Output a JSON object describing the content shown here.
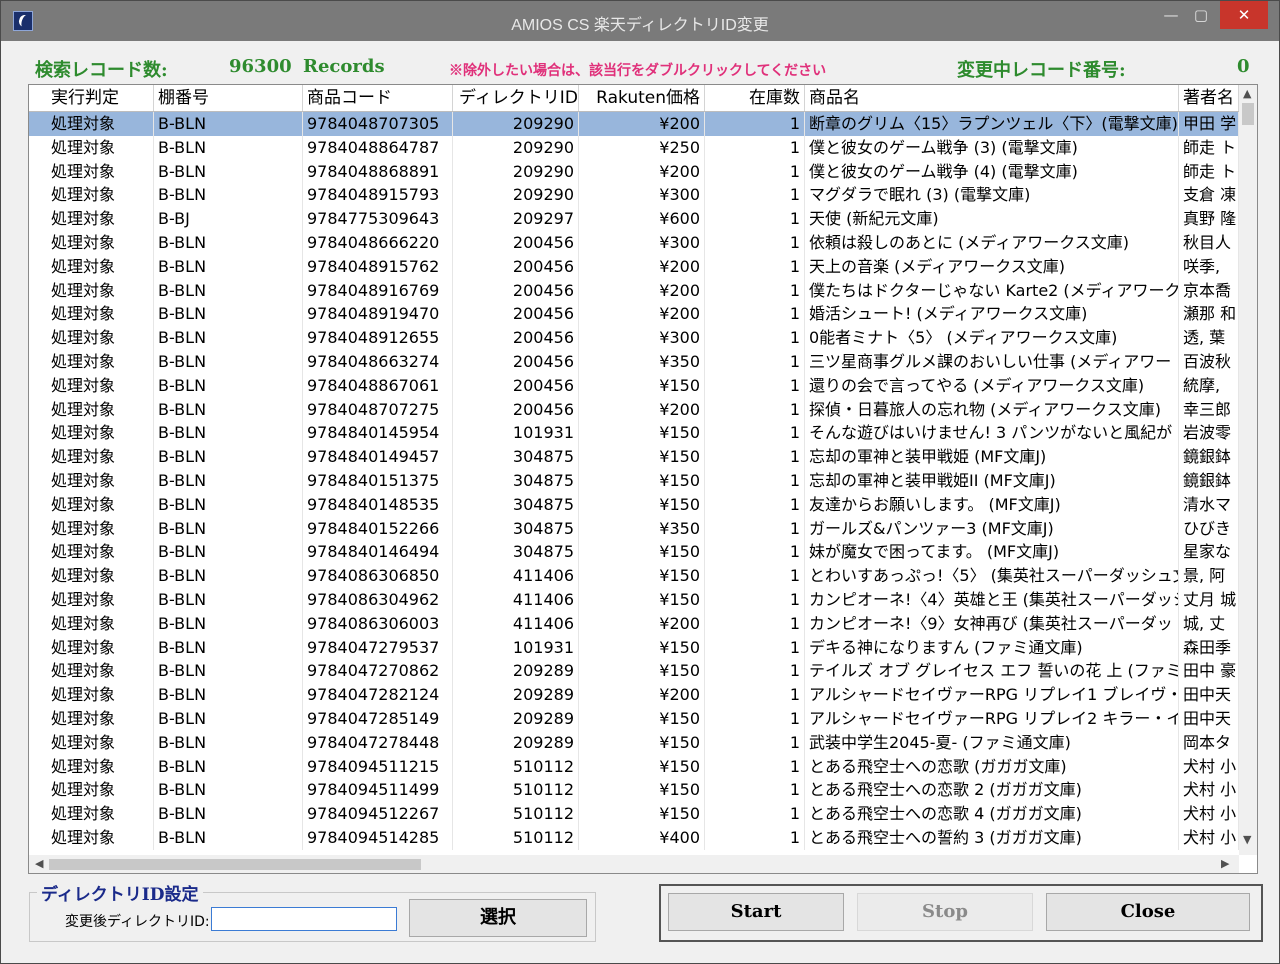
{
  "window": {
    "title": "AMIOS CS 楽天ディレクトリID変更",
    "minimize_glyph": "—",
    "maximize_glyph": "▢",
    "close_glyph": "✕"
  },
  "stats": {
    "search_label": "検索レコード数:",
    "search_count": "96300",
    "records_unit": "Records",
    "notice": "※除外したい場合は、該当行をダブルクリックしてください",
    "changing_label": "変更中レコード番号:",
    "changing_value": "0"
  },
  "table": {
    "columns": [
      "実行判定",
      "棚番号",
      "商品コード",
      "ディレクトリID",
      "Rakuten価格",
      "在庫数",
      "商品名",
      "著者名"
    ],
    "rows": [
      [
        "処理対象",
        "B-BLN",
        "9784048707305",
        "209290",
        "¥200",
        "1",
        "断章のグリム〈15〉ラプンツェル〈下〉(電撃文庫)",
        "甲田 学"
      ],
      [
        "処理対象",
        "B-BLN",
        "9784048864787",
        "209290",
        "¥250",
        "1",
        "僕と彼女のゲーム戦争 (3) (電撃文庫)",
        "師走 ト"
      ],
      [
        "処理対象",
        "B-BLN",
        "9784048868891",
        "209290",
        "¥200",
        "1",
        "僕と彼女のゲーム戦争 (4) (電撃文庫)",
        "師走 ト"
      ],
      [
        "処理対象",
        "B-BLN",
        "9784048915793",
        "209290",
        "¥300",
        "1",
        "マグダラで眠れ (3) (電撃文庫)",
        "支倉 凍"
      ],
      [
        "処理対象",
        "B-BJ",
        "9784775309643",
        "209297",
        "¥600",
        "1",
        "天使 (新紀元文庫)",
        "真野 隆"
      ],
      [
        "処理対象",
        "B-BLN",
        "9784048666220",
        "200456",
        "¥300",
        "1",
        "依頼は殺しのあとに (メディアワークス文庫)",
        "秋目人"
      ],
      [
        "処理対象",
        "B-BLN",
        "9784048915762",
        "200456",
        "¥200",
        "1",
        "天上の音楽 (メディアワークス文庫)",
        "咲季,"
      ],
      [
        "処理対象",
        "B-BLN",
        "9784048916769",
        "200456",
        "¥200",
        "1",
        "僕たちはドクターじゃない Karte2 (メディアワークス",
        "京本喬"
      ],
      [
        "処理対象",
        "B-BLN",
        "9784048919470",
        "200456",
        "¥200",
        "1",
        "婚活シュート! (メディアワークス文庫)",
        "瀬那 和"
      ],
      [
        "処理対象",
        "B-BLN",
        "9784048912655",
        "200456",
        "¥300",
        "1",
        "0能者ミナト〈5〉 (メディアワークス文庫)",
        "透, 葉"
      ],
      [
        "処理対象",
        "B-BLN",
        "9784048663274",
        "200456",
        "¥350",
        "1",
        "三ツ星商事グルメ課のおいしい仕事 (メディアワー",
        "百波秋"
      ],
      [
        "処理対象",
        "B-BLN",
        "9784048867061",
        "200456",
        "¥150",
        "1",
        "還りの会で言ってやる (メディアワークス文庫)",
        "統摩,"
      ],
      [
        "処理対象",
        "B-BLN",
        "9784048707275",
        "200456",
        "¥200",
        "1",
        "探偵・日暮旅人の忘れ物 (メディアワークス文庫)",
        "幸三郎"
      ],
      [
        "処理対象",
        "B-BLN",
        "9784840145954",
        "101931",
        "¥150",
        "1",
        "そんな遊びはいけません! 3 パンツがないと風紀が",
        "岩波零"
      ],
      [
        "処理対象",
        "B-BLN",
        "9784840149457",
        "304875",
        "¥150",
        "1",
        "忘却の軍神と装甲戦姫 (MF文庫J)",
        "鏡銀鉢"
      ],
      [
        "処理対象",
        "B-BLN",
        "9784840151375",
        "304875",
        "¥150",
        "1",
        "忘却の軍神と装甲戦姫II (MF文庫J)",
        "鏡銀鉢"
      ],
      [
        "処理対象",
        "B-BLN",
        "9784840148535",
        "304875",
        "¥150",
        "1",
        "友達からお願いします。 (MF文庫J)",
        "清水マ"
      ],
      [
        "処理対象",
        "B-BLN",
        "9784840152266",
        "304875",
        "¥350",
        "1",
        "ガールズ&パンツァー3 (MF文庫J)",
        "ひびき"
      ],
      [
        "処理対象",
        "B-BLN",
        "9784840146494",
        "304875",
        "¥150",
        "1",
        "妹が魔女で困ってます。 (MF文庫J)",
        "星家な"
      ],
      [
        "処理対象",
        "B-BLN",
        "9784086306850",
        "411406",
        "¥150",
        "1",
        "とわいすあっぷっ!〈5〉 (集英社スーパーダッシュ文",
        "景, 阿"
      ],
      [
        "処理対象",
        "B-BLN",
        "9784086304962",
        "411406",
        "¥150",
        "1",
        "カンピオーネ!〈4〉英雄と王 (集英社スーパーダッシ",
        "丈月 城"
      ],
      [
        "処理対象",
        "B-BLN",
        "9784086306003",
        "411406",
        "¥200",
        "1",
        "カンピオーネ!〈9〉女神再び (集英社スーパーダッ",
        "城, 丈"
      ],
      [
        "処理対象",
        "B-BLN",
        "9784047279537",
        "101931",
        "¥150",
        "1",
        "デキる神になりますん (ファミ通文庫)",
        "森田季"
      ],
      [
        "処理対象",
        "B-BLN",
        "9784047270862",
        "209289",
        "¥150",
        "1",
        "テイルズ オブ グレイセス エフ 誓いの花 上 (ファミ",
        "田中 豪"
      ],
      [
        "処理対象",
        "B-BLN",
        "9784047282124",
        "209289",
        "¥200",
        "1",
        "アルシャードセイヴァーRPG リプレイ1 ブレイヴ・ニ",
        "田中天"
      ],
      [
        "処理対象",
        "B-BLN",
        "9784047285149",
        "209289",
        "¥150",
        "1",
        "アルシャードセイヴァーRPG リプレイ2 キラー・イン・",
        "田中天"
      ],
      [
        "処理対象",
        "B-BLN",
        "9784047278448",
        "209289",
        "¥150",
        "1",
        "武装中学生2045-夏- (ファミ通文庫)",
        "岡本タ"
      ],
      [
        "処理対象",
        "B-BLN",
        "9784094511215",
        "510112",
        "¥150",
        "1",
        "とある飛空士への恋歌 (ガガガ文庫)",
        "犬村 小"
      ],
      [
        "処理対象",
        "B-BLN",
        "9784094511499",
        "510112",
        "¥150",
        "1",
        "とある飛空士への恋歌 2 (ガガガ文庫)",
        "犬村 小"
      ],
      [
        "処理対象",
        "B-BLN",
        "9784094512267",
        "510112",
        "¥150",
        "1",
        "とある飛空士への恋歌 4 (ガガガ文庫)",
        "犬村 小"
      ],
      [
        "処理対象",
        "B-BLN",
        "9784094514285",
        "510112",
        "¥400",
        "1",
        "とある飛空士への誓約 3 (ガガガ文庫)",
        "犬村 小"
      ]
    ],
    "selected_row": 0
  },
  "directory_group": {
    "legend": "ディレクトリID設定",
    "field_label": "変更後ディレクトリID:",
    "field_value": "",
    "select_label": "選択"
  },
  "actions": {
    "start_label": "Start",
    "stop_label": "Stop",
    "close_label": "Close"
  },
  "colors": {
    "stat_green": "#2e8b2e",
    "notice_pink": "#e0307a",
    "legend_blue": "#1a2a8a",
    "selected_row": "#98b6dc",
    "close_red": "#c8352b"
  }
}
